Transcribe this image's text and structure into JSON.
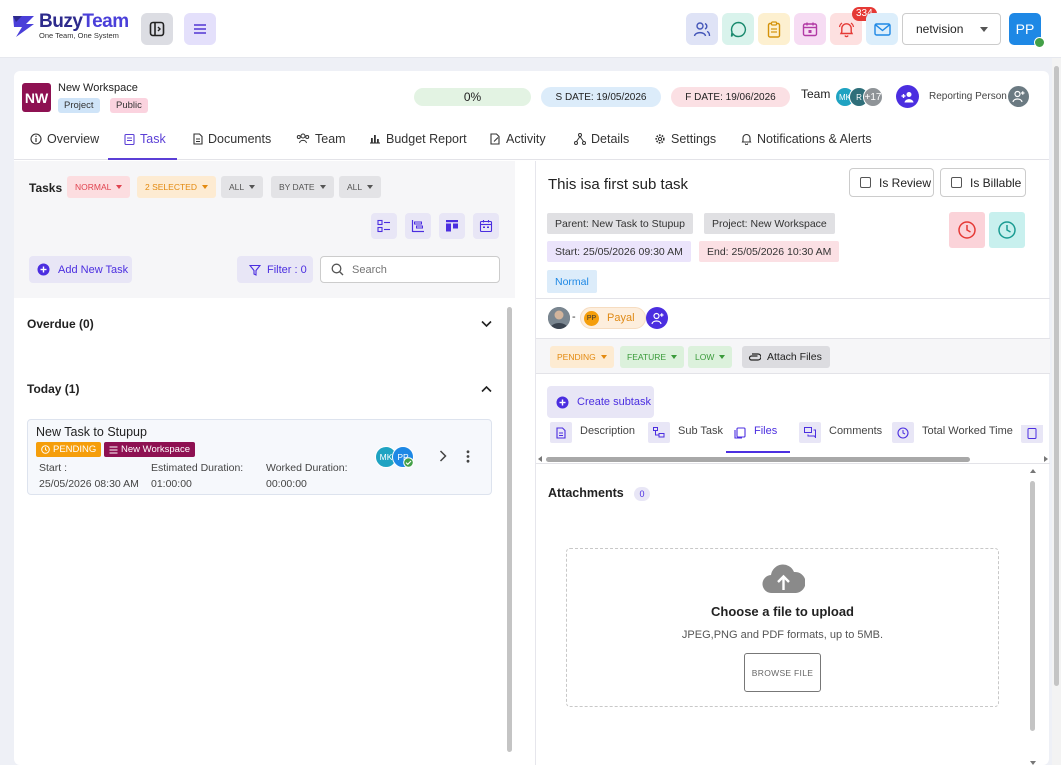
{
  "brand": {
    "name_a": "Buzy",
    "name_b": "Team",
    "tagline": "One Team, One System"
  },
  "header": {
    "notification_count": "334",
    "workspace_select": "netvision",
    "user_initials": "PP"
  },
  "workspace": {
    "initials": "NW",
    "name": "New Workspace",
    "tag_project": "Project",
    "tag_public": "Public",
    "progress": "0%",
    "s_date": "S DATE: 19/05/2026",
    "f_date": "F DATE: 19/06/2026",
    "team_label": "Team",
    "team_members": [
      "MK",
      "R",
      "+17"
    ],
    "reporting_label": "Reporting Person"
  },
  "tabs": [
    {
      "label": "Overview"
    },
    {
      "label": "Task"
    },
    {
      "label": "Documents"
    },
    {
      "label": "Team"
    },
    {
      "label": "Budget Report"
    },
    {
      "label": "Activity"
    },
    {
      "label": "Details"
    },
    {
      "label": "Settings"
    },
    {
      "label": "Notifications & Alerts"
    }
  ],
  "tasks_panel": {
    "label": "Tasks",
    "filters": [
      "NORMAL",
      "2 SELECTED",
      "ALL",
      "BY DATE",
      "ALL"
    ],
    "add_label": "Add New Task",
    "filter_label": "Filter : 0",
    "search_placeholder": "Search",
    "groups": [
      {
        "label": "Overdue (0)"
      },
      {
        "label": "Today (1)"
      }
    ],
    "task": {
      "title": "New Task to Stupup",
      "status": "PENDING",
      "workspace": "New Workspace",
      "start_label": "Start :",
      "start_value": "25/05/2026 08:30 AM",
      "est_label": "Estimated Duration:",
      "est_value": "01:00:00",
      "worked_label": "Worked Duration:",
      "worked_value": "00:00:00",
      "assignees": [
        "MK",
        "PP"
      ]
    }
  },
  "detail": {
    "title": "This isa first sub task",
    "is_review": "Is Review",
    "is_billable": "Is Billable",
    "parent": "Parent:  New Task to Stupup",
    "project": "Project:  New Workspace",
    "start": "Start:  25/05/2026 09:30 AM",
    "end": "End:  25/05/2026 10:30 AM",
    "priority_tag": "Normal",
    "assignee_sep": "-",
    "assignee_initials": "PP",
    "assignee_name": "Payal",
    "props": [
      "PENDING",
      "FEATURE",
      "LOW"
    ],
    "attach_label": "Attach Files",
    "create_subtask": "Create subtask",
    "detail_tabs": [
      "Description",
      "Sub Task",
      "Files",
      "Comments",
      "Total Worked Time"
    ],
    "attachments_title": "Attachments",
    "attachments_count": "0",
    "upload_title": "Choose a file to upload",
    "upload_sub": "JPEG,PNG and PDF formats, up to 5MB.",
    "browse_label": "BROWSE FILE"
  },
  "colors": {
    "accent": "#4b2ee0",
    "workspace": "#8e1152",
    "pending": "#f59e0b",
    "alert": "#e53935"
  }
}
